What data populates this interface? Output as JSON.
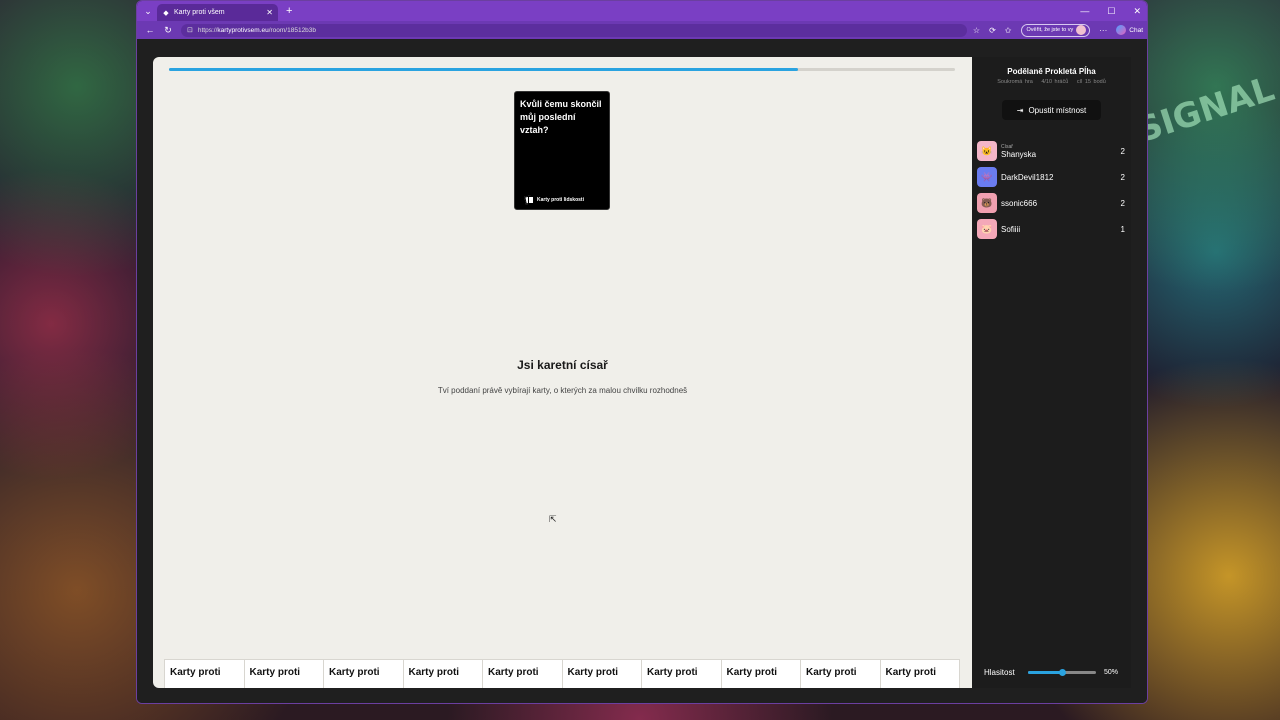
{
  "browser": {
    "tab_title": "Karty proti všem",
    "url_prefix": "https://",
    "url_host": "kartyprotivsem.eu",
    "url_path": "/room/18512b3b",
    "verify_label": "Ověřit, že jste to vy",
    "chat_label": "Chat",
    "icons": {
      "back": "arrow-left-icon",
      "reload": "reload-icon",
      "star": "star-icon",
      "extension": "extension-icon",
      "favorites": "favorites-icon",
      "more": "more-icon"
    }
  },
  "game": {
    "progress": 0.8,
    "black_card": {
      "text": "Kvůli čemu skončil můj poslední vztah?",
      "brand": "Karty proti lidskosti"
    },
    "czar_title": "Jsi karetní císař",
    "czar_subtitle": "Tví poddaní právě vybírají karty, o kterých za malou chvilku rozhodneš",
    "hand": [
      "Karty proti",
      "Karty proti",
      "Karty proti",
      "Karty proti",
      "Karty proti",
      "Karty proti",
      "Karty proti",
      "Karty proti",
      "Karty proti",
      "Karty proti"
    ]
  },
  "sidebar": {
    "room_name": "Podělaně Prokletá Pĺha",
    "room_type": "Soukromá hra",
    "players_count": "4/10 hráčů",
    "goal": "cíl 15 bodů",
    "leave_label": "Opustit místnost",
    "czar_role": "Císař",
    "players": [
      {
        "name": "Shanyska",
        "score": "2",
        "czar": true,
        "color": "#f4b6c8",
        "icon": "😺"
      },
      {
        "name": "DarkDevil1812",
        "score": "2",
        "czar": false,
        "color": "#6a7cf0",
        "icon": "👾"
      },
      {
        "name": "ssonic666",
        "score": "2",
        "czar": false,
        "color": "#f0a0b0",
        "icon": "🐻"
      },
      {
        "name": "Sofiiii",
        "score": "1",
        "czar": false,
        "color": "#f4a8b8",
        "icon": "🐷"
      }
    ],
    "volume_label": "Hlasitost",
    "volume": 0.5,
    "volume_text": "50%"
  }
}
